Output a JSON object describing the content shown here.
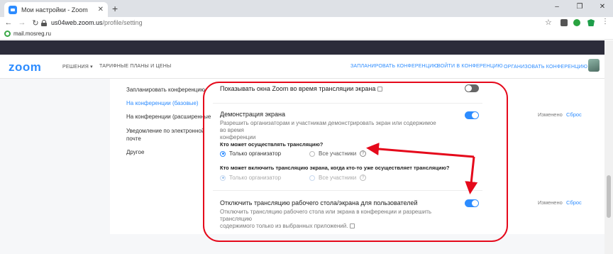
{
  "browser": {
    "tab_title": "Мои настройки - Zoom",
    "tab_close": "✕",
    "new_tab": "+",
    "url_host": "us04web.zoom.us",
    "url_path": "/profile/setting",
    "bookmark": "mail.mosreg.ru",
    "window_controls": [
      "–",
      "❐",
      "✕"
    ]
  },
  "nav": {
    "logo": "zoom",
    "solutions": "РЕШЕНИЯ ▾",
    "plans": "ТАРИФНЫЕ ПЛАНЫ И ЦЕНЫ",
    "schedule": "ЗАПЛАНИРОВАТЬ КОНФЕРЕНЦИЮ",
    "join": "ВОЙТИ В КОНФЕРЕНЦИЮ",
    "host": "ОРГАНИЗОВАТЬ КОНФЕРЕНЦИЮ ▾"
  },
  "sidebar": {
    "items": [
      {
        "label": "Запланировать конференцию"
      },
      {
        "label": "На конференции (базовые)"
      },
      {
        "label": "На конференции (расширенные"
      },
      {
        "label": "Уведомление по электронной"
      },
      {
        "label": "почте"
      },
      {
        "label": "Другое"
      }
    ]
  },
  "settings": {
    "show_windows": {
      "title": "Показывать окна Zoom во время трансляции экрана",
      "enabled": false
    },
    "screen_share": {
      "title": "Демонстрация экрана",
      "desc_line1": "Разрешить организаторам и участникам демонстрировать экран или содержимое во время",
      "desc_line2": "конференции",
      "enabled": true,
      "q1": "Кто может осуществлять трансляцию?",
      "q1_opt1": "Только организатор",
      "q1_opt2": "Все участники",
      "q2": "Кто может включить трансляцию экрана, когда кто-то уже осуществляет трансляцию?",
      "q2_opt1": "Только организатор",
      "q2_opt2": "Все участники",
      "info": "?"
    },
    "disable_desktop": {
      "title": "Отключить трансляцию рабочего стола/экрана для пользователей",
      "desc_line1": "Отключить трансляцию рабочего стола или экрана в конференции и разрешить трансляцию",
      "desc_line2": "содержимого только из выбранных приложений.",
      "enabled": true
    },
    "changed_label": "Изменено",
    "reset_label": "Сброс"
  },
  "colors": {
    "accent": "#2d8cff",
    "annotation": "#e5091b"
  }
}
